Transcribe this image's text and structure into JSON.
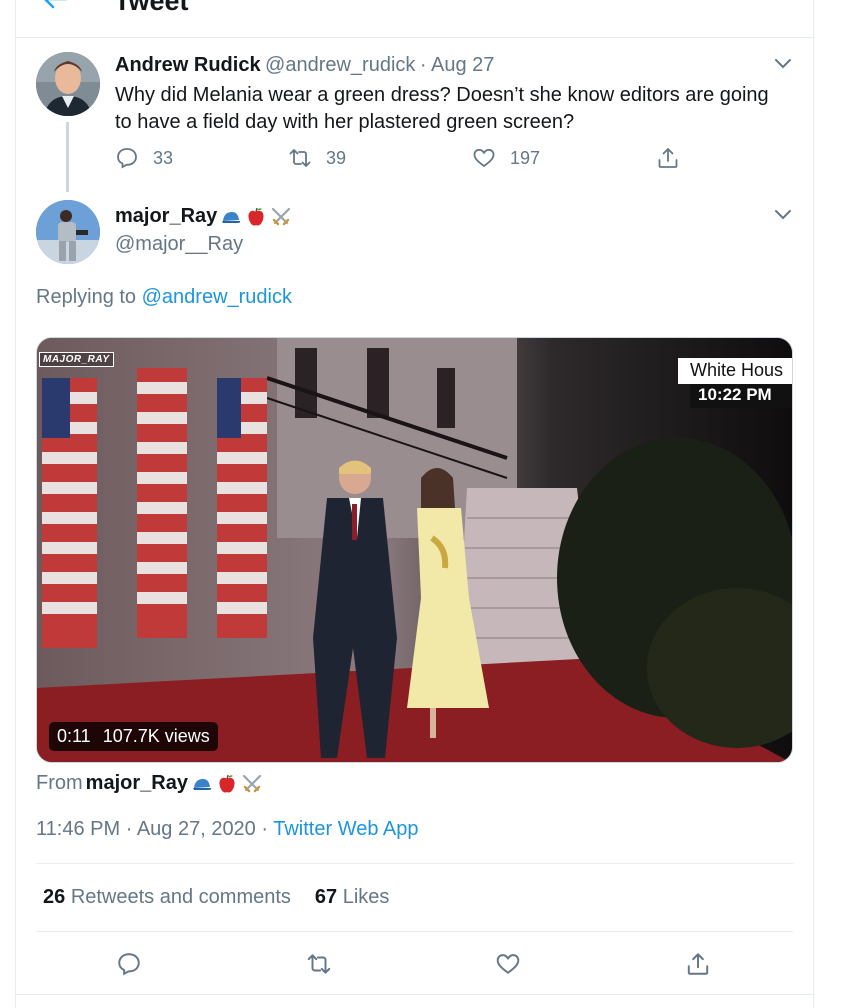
{
  "header": {
    "title": "Tweet",
    "back_icon": "arrow-left-icon"
  },
  "parent_tweet": {
    "name": "Andrew Rudick",
    "handle": "@andrew_rudick",
    "separator": "·",
    "date": "Aug 27",
    "text": "Why did Melania wear a green dress? Doesn’t she know editors are going to have a field day with her plastered green screen?",
    "replies": "33",
    "retweets": "39",
    "likes": "197"
  },
  "reply_tweet": {
    "name": "major_Ray",
    "name_emojis": [
      "blue-cap-emoji",
      "apple-emoji",
      "crossed-swords-emoji"
    ],
    "handle": "@major__Ray",
    "replying_prefix": "Replying to",
    "replying_handle": "@andrew_rudick",
    "video": {
      "watermark": "MAJOR_RAY",
      "lower_third_title": "White Hous",
      "lower_third_time": "10:22 PM",
      "duration": "0:11",
      "views": "107.7K views"
    },
    "from_prefix": "From",
    "from_name": "major_Ray",
    "time": "11:46 PM",
    "date": "Aug 27, 2020",
    "separator": "·",
    "source": "Twitter Web App",
    "retweets_count": "26",
    "retweets_label": "Retweets and comments",
    "likes_count": "67",
    "likes_label": "Likes"
  },
  "colors": {
    "accent": "#1b95e0",
    "secondary_text": "#657786",
    "primary_text": "#14171a",
    "border": "#e6ecf0"
  }
}
